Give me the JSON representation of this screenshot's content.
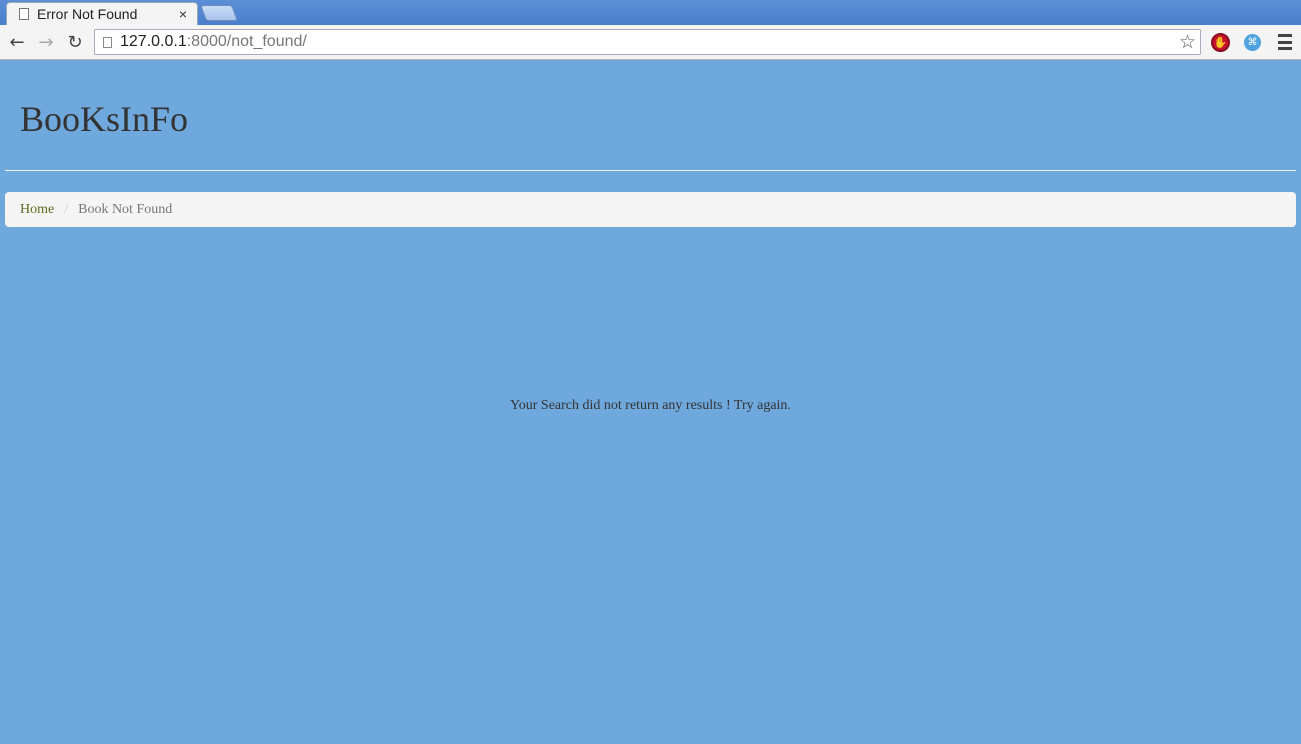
{
  "browser": {
    "tab_title": "Error Not Found",
    "close_glyph": "×",
    "url_host": "127.0.0.1",
    "url_path": ":8000/not_found/",
    "back_glyph": "←",
    "forward_glyph": "→",
    "reload_glyph": "↻",
    "star_glyph": "☆",
    "ext_stop_glyph": "✋",
    "ext_cmd_glyph": "⌘"
  },
  "page": {
    "site_title": "BooKsInFo",
    "breadcrumb": {
      "home": "Home",
      "separator": "/",
      "current": "Book Not Found"
    },
    "message": "Your Search did not return any results ! Try again."
  },
  "colors": {
    "page_background": "#6fa8dc",
    "breadcrumb_background": "#f5f5f5",
    "home_link": "#5a6e1a"
  }
}
